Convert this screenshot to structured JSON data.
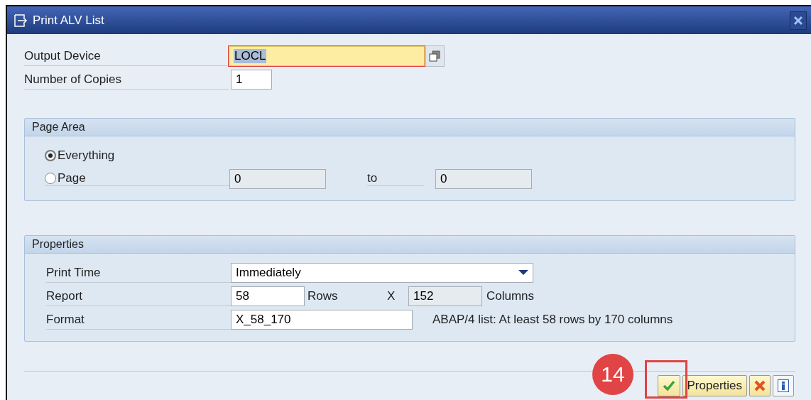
{
  "window": {
    "title": "Print ALV List"
  },
  "output_device": {
    "label": "Output Device",
    "value": "LOCL"
  },
  "copies": {
    "label": "Number of Copies",
    "value": "1"
  },
  "page_area": {
    "title": "Page Area",
    "options": [
      {
        "label": "Everything",
        "selected": true
      },
      {
        "label": "Page",
        "selected": false
      }
    ],
    "from": "0",
    "to_label": "to",
    "to": "0"
  },
  "properties": {
    "title": "Properties",
    "print_time": {
      "label": "Print Time",
      "value": "Immediately"
    },
    "report": {
      "label": "Report",
      "rows": "58",
      "rows_label": "Rows",
      "x_label": "X",
      "columns": "152",
      "columns_label": "Columns"
    },
    "format": {
      "label": "Format",
      "value": "X_58_170",
      "note": "ABAP/4 list: At least 58 rows by 170 columns"
    }
  },
  "step_badge": "14",
  "buttons": [
    {
      "kind": "confirm"
    },
    {
      "kind": "text",
      "label": "Properties"
    },
    {
      "kind": "cancel"
    },
    {
      "kind": "info"
    }
  ]
}
